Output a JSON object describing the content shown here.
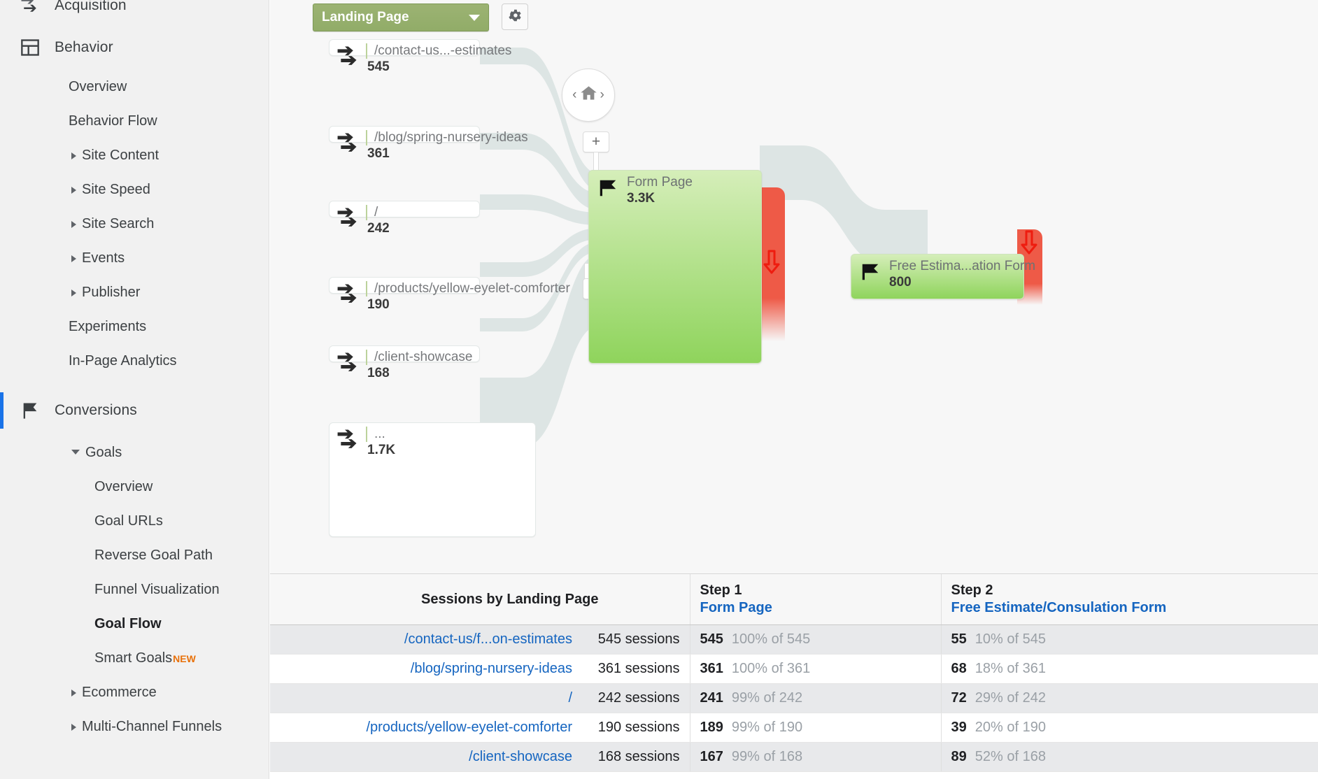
{
  "sidebar": {
    "groups": [
      {
        "label": "Acquisition",
        "icon": "acquisition-arrows-icon",
        "active": false,
        "items": []
      },
      {
        "label": "Behavior",
        "icon": "behavior-layout-icon",
        "active": false,
        "items": [
          {
            "label": "Overview",
            "level": 1,
            "expandable": false,
            "bold": false
          },
          {
            "label": "Behavior Flow",
            "level": 1,
            "expandable": false,
            "bold": false
          },
          {
            "label": "Site Content",
            "level": 2,
            "expandable": true,
            "bold": false
          },
          {
            "label": "Site Speed",
            "level": 2,
            "expandable": true,
            "bold": false
          },
          {
            "label": "Site Search",
            "level": 2,
            "expandable": true,
            "bold": false
          },
          {
            "label": "Events",
            "level": 2,
            "expandable": true,
            "bold": false
          },
          {
            "label": "Publisher",
            "level": 2,
            "expandable": true,
            "bold": false
          },
          {
            "label": "Experiments",
            "level": 1,
            "expandable": false,
            "bold": false
          },
          {
            "label": "In-Page Analytics",
            "level": 1,
            "expandable": false,
            "bold": false
          }
        ]
      },
      {
        "label": "Conversions",
        "icon": "conversions-flag-icon",
        "active": true,
        "items": [
          {
            "label": "Goals",
            "level": 2,
            "expandable": true,
            "expanded": true,
            "bold": false
          },
          {
            "label": "Overview",
            "level": 3,
            "expandable": false,
            "bold": false
          },
          {
            "label": "Goal URLs",
            "level": 3,
            "expandable": false,
            "bold": false
          },
          {
            "label": "Reverse Goal Path",
            "level": 3,
            "expandable": false,
            "bold": false
          },
          {
            "label": "Funnel Visualization",
            "level": 3,
            "expandable": false,
            "bold": false
          },
          {
            "label": "Goal Flow",
            "level": 3,
            "expandable": false,
            "bold": true
          },
          {
            "label": "Smart Goals",
            "level": 3,
            "expandable": false,
            "bold": false,
            "badge": "NEW"
          },
          {
            "label": "Ecommerce",
            "level": 2,
            "expandable": true,
            "bold": false
          },
          {
            "label": "Multi-Channel Funnels",
            "level": 2,
            "expandable": true,
            "bold": false
          }
        ]
      }
    ]
  },
  "toolbar": {
    "dimension_label": "Landing Page",
    "settings_icon": "gear-icon",
    "dropdown_icon": "chevron-down-icon"
  },
  "canvas_controls": {
    "home_icon": "home-icon",
    "prev_icon": "chevron-left-icon",
    "next_icon": "chevron-right-icon",
    "zoom_in_label": "+",
    "zoom_out_label": "-"
  },
  "flow": {
    "source_nodes": [
      {
        "label": "/contact-us...-estimates",
        "value": "545",
        "icon": "page-flow-icon"
      },
      {
        "label": "/blog/spring-nursery-ideas",
        "value": "361",
        "icon": "page-flow-icon"
      },
      {
        "label": "/",
        "value": "242",
        "icon": "page-flow-icon"
      },
      {
        "label": "/products/yellow-eyelet-comforter",
        "value": "190",
        "icon": "page-flow-icon"
      },
      {
        "label": "/client-showcase",
        "value": "168",
        "icon": "page-flow-icon"
      },
      {
        "label": "...",
        "value": "1.7K",
        "icon": "page-flow-icon"
      }
    ],
    "goal_nodes": [
      {
        "label": "Form Page",
        "value": "3.3K",
        "icon": "goal-flag-icon"
      },
      {
        "label": "Free Estima...ation Form",
        "value": "800",
        "icon": "goal-flag-icon"
      }
    ],
    "dropoff_icon": "dropoff-down-arrow-icon"
  },
  "table": {
    "headers": {
      "spacer": "",
      "sessions_by": "Sessions by Landing Page",
      "step1_label": "Step 1",
      "step1_name": "Form Page",
      "step2_label": "Step 2",
      "step2_name": "Free Estimate/Consulation Form"
    },
    "rows": [
      {
        "page": "/contact-us/f...on-estimates",
        "sessions": "545 sessions",
        "s1_num": "545",
        "s1_pct": "100% of 545",
        "s2_num": "55",
        "s2_pct": "10% of 545"
      },
      {
        "page": "/blog/spring-nursery-ideas",
        "sessions": "361 sessions",
        "s1_num": "361",
        "s1_pct": "100% of 361",
        "s2_num": "68",
        "s2_pct": "18% of 361"
      },
      {
        "page": "/",
        "sessions": "242 sessions",
        "s1_num": "241",
        "s1_pct": "99% of 242",
        "s2_num": "72",
        "s2_pct": "29% of 242"
      },
      {
        "page": "/products/yellow-eyelet-comforter",
        "sessions": "190 sessions",
        "s1_num": "189",
        "s1_pct": "99% of 190",
        "s2_num": "39",
        "s2_pct": "20% of 190"
      },
      {
        "page": "/client-showcase",
        "sessions": "168 sessions",
        "s1_num": "167",
        "s1_pct": "99% of 168",
        "s2_num": "89",
        "s2_pct": "52% of 168"
      }
    ]
  },
  "colors": {
    "accent_green": "#91ac68",
    "goal_green_top": "#d5eeb9",
    "goal_green_bottom": "#8fd45c",
    "dropoff_red": "#ee5a47",
    "link_blue": "#1565c0",
    "active_blue": "#1a73e8",
    "new_orange": "#e8710a",
    "flow_band": "#dde5e4"
  }
}
